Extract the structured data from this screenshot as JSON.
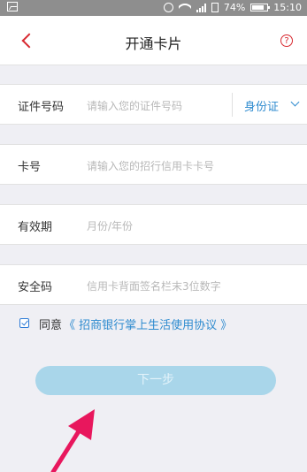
{
  "status_bar": {
    "battery": "74%",
    "time": "15:10",
    "icons": [
      "image-icon",
      "alarm-icon",
      "wifi-icon",
      "signal-icon",
      "sim-icon",
      "battery-icon"
    ]
  },
  "header": {
    "back_icon": "chevron-left-icon",
    "title": "开通卡片",
    "help_icon": "help-icon",
    "help_glyph": "?"
  },
  "form": {
    "id_number": {
      "label": "证件号码",
      "placeholder": "请输入您的证件号码",
      "id_type": "身份证"
    },
    "card_number": {
      "label": "卡号",
      "placeholder": "请输入您的招行信用卡卡号"
    },
    "expiry": {
      "label": "有效期",
      "placeholder": "月份/年份"
    },
    "security_code": {
      "label": "安全码",
      "placeholder": "信用卡背面签名栏末3位数字"
    }
  },
  "agreement": {
    "checked": true,
    "text": "同意",
    "link": "《 招商银行掌上生活使用协议 》"
  },
  "next_button": {
    "label": "下一步",
    "enabled": false
  },
  "colors": {
    "accent_red": "#d7282f",
    "link_blue": "#2e8bcf",
    "button_disabled": "#a9d6ea",
    "background": "#efeff4",
    "annotation_arrow": "#e8175d"
  }
}
